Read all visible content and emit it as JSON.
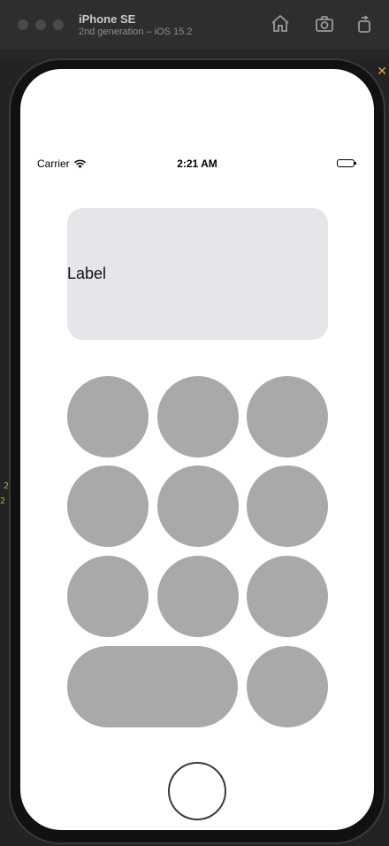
{
  "window": {
    "title": "iPhone SE",
    "subtitle": "2nd generation – iOS 15.2",
    "toolbar": {
      "home_icon": "home-icon",
      "screenshot_icon": "camera-icon",
      "rotate_icon": "rotate-icon"
    }
  },
  "backdrop": {
    "close_glyph": "✕",
    "gutter_a": "2",
    "gutter_b": "2"
  },
  "status_bar": {
    "carrier": "Carrier",
    "time": "2:21 AM",
    "wifi_icon": "wifi-icon",
    "battery_icon": "battery-icon"
  },
  "display": {
    "label": "Label",
    "background": "#e6e5ea"
  },
  "keypad": {
    "key_color": "#a9a9a9",
    "rows": [
      [
        "",
        "",
        ""
      ],
      [
        "",
        "",
        ""
      ],
      [
        "",
        "",
        ""
      ],
      [
        "",
        ""
      ]
    ]
  }
}
